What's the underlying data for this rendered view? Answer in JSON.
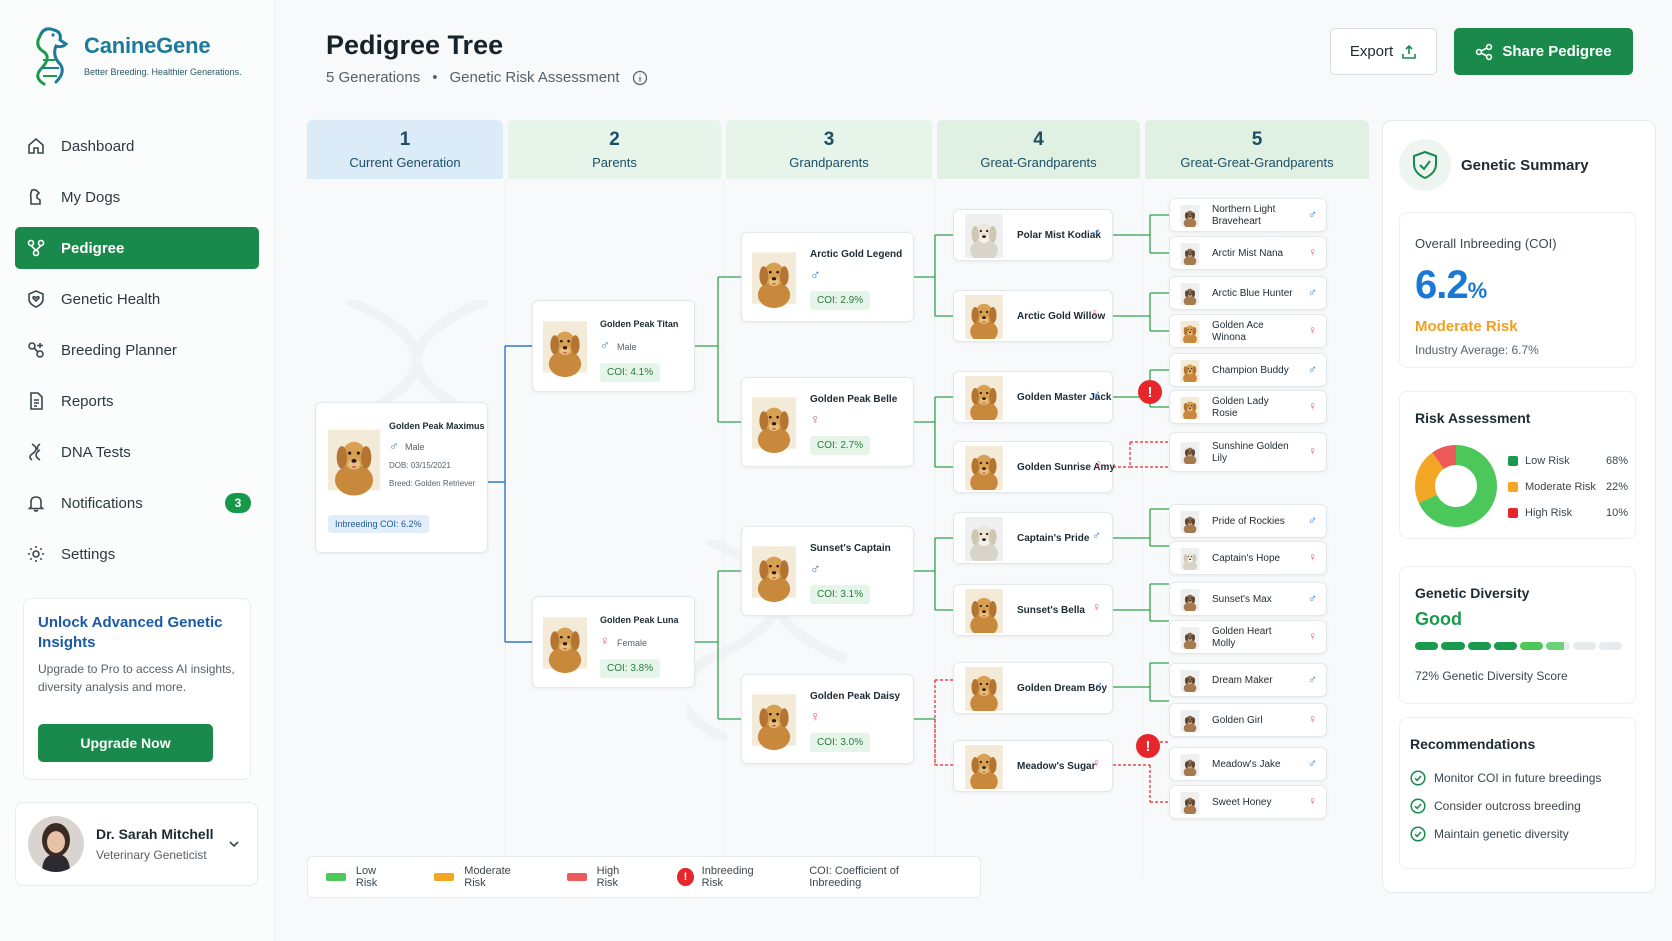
{
  "brand": {
    "name": "CanineGene",
    "tagline": "Better Breeding. Healthier Generations."
  },
  "nav": [
    {
      "label": "Dashboard",
      "icon": "home-icon"
    },
    {
      "label": "My Dogs",
      "icon": "dog-icon"
    },
    {
      "label": "Pedigree",
      "icon": "pedigree-icon",
      "active": true
    },
    {
      "label": "Genetic Health",
      "icon": "shield-heart-icon"
    },
    {
      "label": "Breeding Planner",
      "icon": "breeding-icon"
    },
    {
      "label": "Reports",
      "icon": "document-icon"
    },
    {
      "label": "DNA Tests",
      "icon": "dna-icon"
    },
    {
      "label": "Notifications",
      "icon": "bell-icon",
      "badge": "3"
    },
    {
      "label": "Settings",
      "icon": "gear-icon"
    }
  ],
  "promo": {
    "title": "Unlock Advanced Genetic Insights",
    "desc": "Upgrade to Pro to access AI insights, diversity analysis and more.",
    "button": "Upgrade Now"
  },
  "user": {
    "name": "Dr. Sarah Mitchell",
    "role": "Veterinary Geneticist"
  },
  "header": {
    "title": "Pedigree Tree",
    "generations": "5 Generations",
    "subtitle": "Genetic Risk Assessment",
    "export": "Export",
    "share": "Share Pedigree"
  },
  "generation_headers": [
    {
      "num": "1",
      "label": "Current Generation"
    },
    {
      "num": "2",
      "label": "Parents"
    },
    {
      "num": "3",
      "label": "Grandparents"
    },
    {
      "num": "4",
      "label": "Great-Grandparents"
    },
    {
      "num": "5",
      "label": "Great-Great-Grandparents"
    }
  ],
  "subject": {
    "name": "Golden Peak Maximus",
    "sex": "Male",
    "dob": "DOB: 03/15/2021",
    "breed": "Breed: Golden Retriever",
    "coi": "Inbreeding COI: 6.2%"
  },
  "parents": [
    {
      "name": "Golden Peak Titan",
      "sex": "male",
      "sex_label": "Male",
      "coi": "COI: 4.1%"
    },
    {
      "name": "Golden Peak Luna",
      "sex": "female",
      "sex_label": "Female",
      "coi": "COI: 3.8%"
    }
  ],
  "grandparents": [
    {
      "name": "Arctic Gold Legend",
      "sex": "male",
      "coi": "COI: 2.9%"
    },
    {
      "name": "Golden Peak Belle",
      "sex": "female",
      "coi": "COI: 2.7%"
    },
    {
      "name": "Sunset's Captain",
      "sex": "male",
      "coi": "COI: 3.1%"
    },
    {
      "name": "Golden Peak Daisy",
      "sex": "female",
      "coi": "COI: 3.0%"
    }
  ],
  "great_grandparents": [
    {
      "name": "Polar Mist Kodiak",
      "sex": "male"
    },
    {
      "name": "Arctic Gold Willow",
      "sex": "female"
    },
    {
      "name": "Golden Master Jack",
      "sex": "male"
    },
    {
      "name": "Golden Sunrise Amy",
      "sex": "female"
    },
    {
      "name": "Captain's Pride",
      "sex": "male"
    },
    {
      "name": "Sunset's Bella",
      "sex": "female"
    },
    {
      "name": "Golden Dream Boy",
      "sex": "male"
    },
    {
      "name": "Meadow's Sugar",
      "sex": "female"
    }
  ],
  "great_great_grandparents": [
    {
      "name": "Northern Light Braveheart",
      "sex": "male"
    },
    {
      "name": "Arctir Mist Nana",
      "sex": "female"
    },
    {
      "name": "Arctic Blue Hunter",
      "sex": "male"
    },
    {
      "name": "Golden Ace Winona",
      "sex": "female"
    },
    {
      "name": "Champion Buddy",
      "sex": "male"
    },
    {
      "name": "Golden Lady Rosie",
      "sex": "female"
    },
    {
      "name": "Sunshine Golden Lily",
      "sex": "female"
    },
    {
      "name": "Pride of Rockies",
      "sex": "male"
    },
    {
      "name": "Captain's Hope",
      "sex": "female"
    },
    {
      "name": "Sunset's Max",
      "sex": "male"
    },
    {
      "name": "Golden Heart Molly",
      "sex": "female"
    },
    {
      "name": "Dream Maker",
      "sex": "male"
    },
    {
      "name": "Golden Girl",
      "sex": "female"
    },
    {
      "name": "Meadow's Jake",
      "sex": "male"
    },
    {
      "name": "Sweet Honey",
      "sex": "female"
    }
  ],
  "legend": [
    {
      "label": "Low Risk",
      "color": "#4cc75a"
    },
    {
      "label": "Moderate Risk",
      "color": "#f2a623"
    },
    {
      "label": "High Risk",
      "color": "#ee5a5a"
    },
    {
      "label": "Inbreeding Risk",
      "icon": "alert-icon"
    },
    {
      "label": "COI: Coefficient of Inbreeding"
    }
  ],
  "summary": {
    "title": "Genetic Summary",
    "coi_label": "Overall Inbreeding (COI)",
    "coi_value": "6.2",
    "coi_unit": "%",
    "coi_risk": "Moderate Risk",
    "industry_avg": "Industry Average: 6.7%",
    "risk_title": "Risk Assessment",
    "risk": [
      {
        "label": "Low Risk",
        "value": "68%",
        "pct": 68,
        "color": "#4cc75a"
      },
      {
        "label": "Moderate Risk",
        "value": "22%",
        "pct": 22,
        "color": "#f2a623"
      },
      {
        "label": "High Risk",
        "value": "10%",
        "pct": 10,
        "color": "#ee5a5a"
      }
    ],
    "diversity_title": "Genetic Diversity",
    "diversity_rating": "Good",
    "diversity_score": "72% Genetic Diversity Score",
    "diversity_pct": 72,
    "rec_title": "Recommendations",
    "recommendations": [
      "Monitor COI in future breedings",
      "Consider outcross breeding",
      "Maintain genetic diversity"
    ]
  }
}
